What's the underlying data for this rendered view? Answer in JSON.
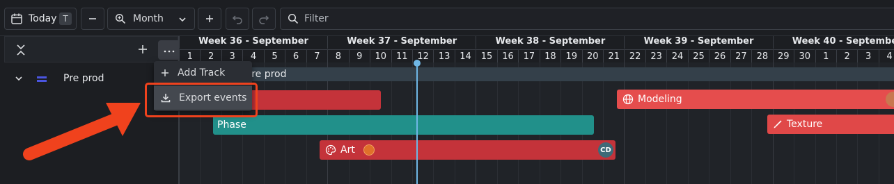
{
  "toolbar": {
    "today_label": "Today",
    "today_shortcut": "T",
    "zoom_value": "Month",
    "filter_placeholder": "Filter"
  },
  "sidebar": {
    "track_label": "Pre prod"
  },
  "menu": {
    "add_track": "Add Track",
    "export_events": "Export events"
  },
  "timeline": {
    "weeks": [
      "Week 36 - September",
      "Week 37 - September",
      "Week 38 - September",
      "Week 39 - September",
      "Week 40 - September"
    ],
    "days": [
      "1",
      "2",
      "3",
      "4",
      "5",
      "6",
      "7",
      "8",
      "9",
      "10",
      "11",
      "12",
      "13",
      "14",
      "15",
      "16",
      "17",
      "18",
      "19",
      "20",
      "21",
      "22",
      "23",
      "24",
      "25",
      "26",
      "27",
      "28",
      "29",
      "30",
      "1",
      "2",
      "3",
      "4"
    ],
    "group_label": "Pre prod",
    "bars": {
      "modeling": "Modeling",
      "phase": "Phase",
      "texture": "Texture",
      "art": "Art",
      "art_assignee": "CD"
    }
  },
  "colors": {
    "highlight": "#f0421d",
    "today_line": "#6fb7e6",
    "red_bar": "#c4333a",
    "teal_bar": "#21908a"
  }
}
